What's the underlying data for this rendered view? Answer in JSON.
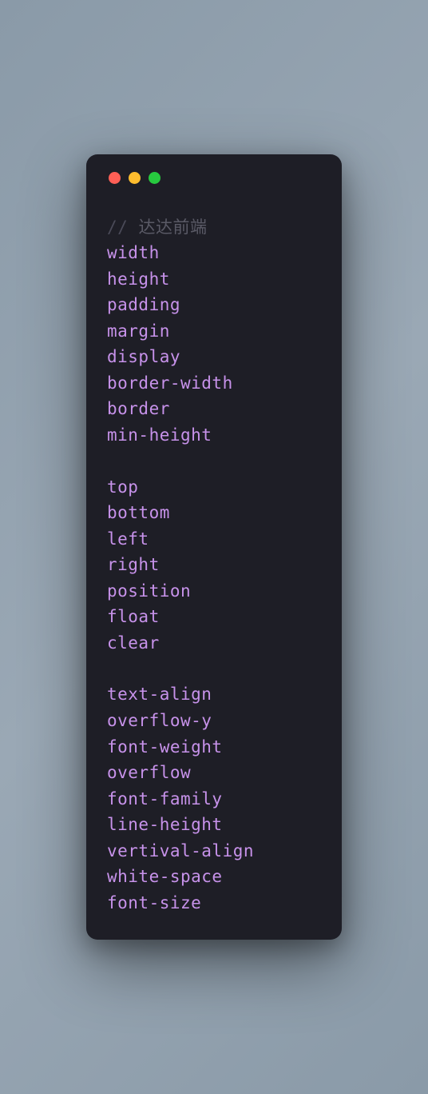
{
  "window": {
    "traffic_lights": {
      "red": "#ff5f56",
      "yellow": "#ffbd2e",
      "green": "#27c93f"
    }
  },
  "code": {
    "comment_prefix": "//",
    "comment_text": " 达达前端",
    "group1": [
      "width",
      "height",
      "padding",
      "margin",
      "display",
      "border-width",
      "border",
      "min-height"
    ],
    "group2": [
      "top",
      "bottom",
      "left",
      "right",
      "position",
      "float",
      "clear"
    ],
    "group3": [
      "text-align",
      "overflow-y",
      "font-weight",
      "overflow",
      "font-family",
      "line-height",
      "vertival-align",
      "white-space",
      "font-size"
    ]
  }
}
